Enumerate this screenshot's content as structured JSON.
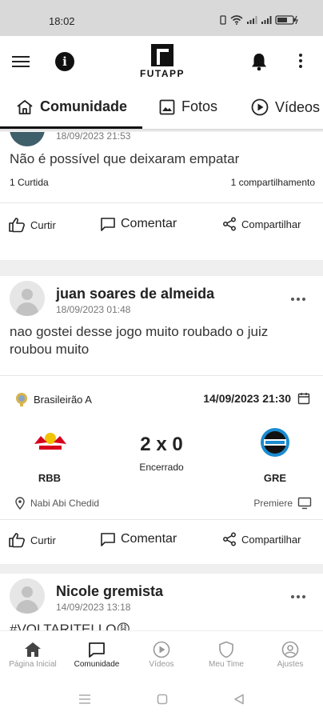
{
  "status_bar": {
    "time": "18:02"
  },
  "app": {
    "logo_text": "FUTAPP"
  },
  "tabs": [
    {
      "label": "Comunidade",
      "icon": "home-icon",
      "active": true
    },
    {
      "label": "Fotos",
      "icon": "image-icon",
      "active": false
    },
    {
      "label": "Vídeos",
      "icon": "play-circle-icon",
      "active": false
    }
  ],
  "posts": [
    {
      "author": "",
      "date": "18/09/2023 21:53",
      "text": "Não é possível que deixaram empatar",
      "likes_count": "1 Curtida",
      "shares_count": "1 compartilhamento"
    },
    {
      "author": "juan soares de almeida",
      "date": "18/09/2023 01:48",
      "text": "nao gostei desse jogo muito roubado o juiz roubou muito",
      "match": {
        "league": "Brasileirão A",
        "datetime": "14/09/2023 21:30",
        "home_team": "RBB",
        "away_team": "GRE",
        "score": "2 x 0",
        "status": "Encerrado",
        "venue": "Nabi Abi Chedid",
        "broadcaster": "Premiere"
      }
    },
    {
      "author": "Nicole gremista",
      "date": "14/09/2023 13:18",
      "text": "#VOLTARITELLO😩"
    }
  ],
  "actions": {
    "like": "Curtir",
    "comment": "Comentar",
    "share": "Compartilhar"
  },
  "bottom_nav": [
    {
      "label": "Página Inicial",
      "icon": "home-icon"
    },
    {
      "label": "Comunidade",
      "icon": "chat-icon",
      "active": true
    },
    {
      "label": "Vídeos",
      "icon": "play-circle-icon"
    },
    {
      "label": "Meu Time",
      "icon": "shield-icon"
    },
    {
      "label": "Ajustes",
      "icon": "user-circle-icon"
    }
  ],
  "colors": {
    "status_bar": "#d9d9d9",
    "feed_bg": "#efefef",
    "text": "#222222",
    "muted": "#999999",
    "rbb_red": "#d6001c",
    "gremio_blue": "#1a8bd0"
  }
}
